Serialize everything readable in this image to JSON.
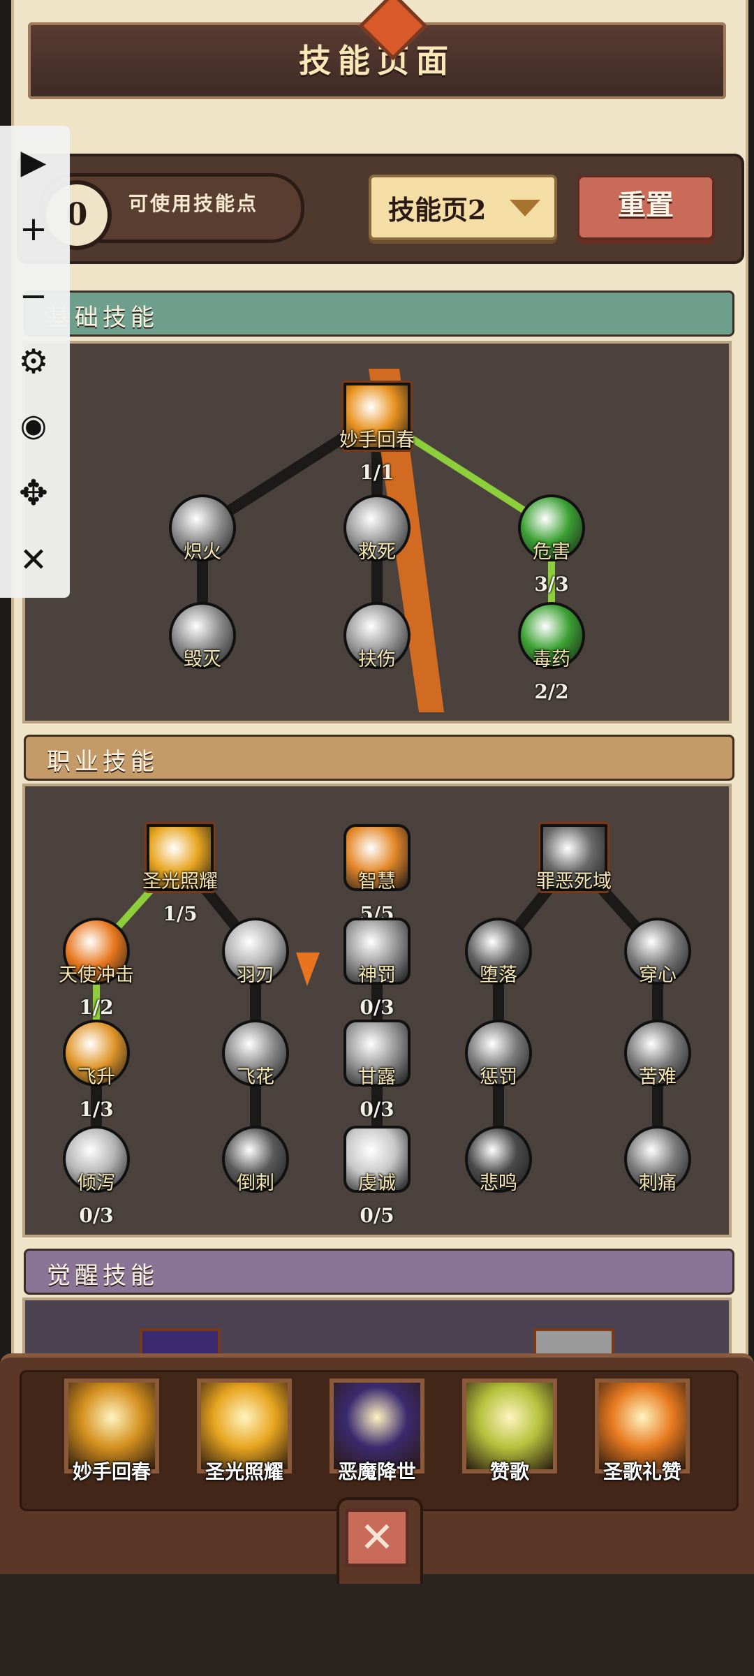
{
  "header": {
    "title": "技能页面"
  },
  "topbar": {
    "points_value": "0",
    "points_label": "可使用技能点",
    "page_select_value": "技能页2",
    "reset_label": "重置"
  },
  "sections": {
    "basic": {
      "title": "基础技能",
      "color": "#6e9e8c"
    },
    "class": {
      "title": "职业技能",
      "color": "#c39a68"
    },
    "awaken": {
      "title": "觉醒技能",
      "color": "#8a7596"
    }
  },
  "basic_skills": [
    {
      "key": "miaoshou",
      "label": "妙手回春",
      "count": "1/1",
      "icon": "golden-hand-icon",
      "color": "#e8921f",
      "shape": "square"
    },
    {
      "key": "chihuo",
      "label": "炽火",
      "count": "",
      "icon": "fire-strike-icon",
      "color": "#8c8c8c",
      "shape": "circle"
    },
    {
      "key": "jiusi",
      "label": "救死",
      "count": "",
      "icon": "revive-icon",
      "color": "#9a9a9a",
      "shape": "circle"
    },
    {
      "key": "weihai",
      "label": "危害",
      "count": "3/3",
      "icon": "green-spikes-icon",
      "color": "#3aa032",
      "shape": "circle"
    },
    {
      "key": "huimie",
      "label": "毁灭",
      "count": "",
      "icon": "destroy-icon",
      "color": "#8a8a8a",
      "shape": "circle"
    },
    {
      "key": "fushang",
      "label": "扶伤",
      "count": "",
      "icon": "heal-wound-icon",
      "color": "#9a9a9a",
      "shape": "circle"
    },
    {
      "key": "duyao",
      "label": "毒药",
      "count": "2/2",
      "icon": "poison-icon",
      "color": "#3aa032",
      "shape": "circle"
    }
  ],
  "class_skills": [
    {
      "key": "shengguang",
      "label": "圣光照耀",
      "count": "1/5",
      "icon": "holy-light-icon",
      "color": "#e7a51f",
      "shape": "square"
    },
    {
      "key": "zhihui",
      "label": "智慧",
      "count": "5/5",
      "icon": "wisdom-crown-icon",
      "color": "#e4882a",
      "shape": "roundsq"
    },
    {
      "key": "zuie",
      "label": "罪恶死域",
      "count": "",
      "icon": "death-domain-icon",
      "color": "#6a6a6a",
      "shape": "square"
    },
    {
      "key": "tianshi",
      "label": "天使冲击",
      "count": "1/2",
      "icon": "angel-strike-icon",
      "color": "#e8781f",
      "shape": "circle"
    },
    {
      "key": "yuren",
      "label": "羽刃",
      "count": "",
      "icon": "feather-blade-icon",
      "color": "#b0b0b0",
      "shape": "circle"
    },
    {
      "key": "shenfa",
      "label": "神罚",
      "count": "0/3",
      "icon": "divine-punish-icon",
      "color": "#9a9a9a",
      "shape": "roundsq"
    },
    {
      "key": "zhuiluo",
      "label": "堕落",
      "count": "",
      "icon": "fall-icon",
      "color": "#606060",
      "shape": "circle"
    },
    {
      "key": "chuanxin",
      "label": "穿心",
      "count": "",
      "icon": "pierce-heart-icon",
      "color": "#7a7a7a",
      "shape": "circle"
    },
    {
      "key": "feisheng",
      "label": "飞升",
      "count": "1/3",
      "icon": "ascend-icon",
      "color": "#e0962a",
      "shape": "circle"
    },
    {
      "key": "feihua",
      "label": "飞花",
      "count": "",
      "icon": "flying-petal-icon",
      "color": "#8a8a8a",
      "shape": "circle"
    },
    {
      "key": "ganlu",
      "label": "甘露",
      "count": "0/3",
      "icon": "dew-icon",
      "color": "#9a9a9a",
      "shape": "roundsq"
    },
    {
      "key": "chengfa",
      "label": "惩罚",
      "count": "",
      "icon": "punish-icon",
      "color": "#7a7a7a",
      "shape": "circle"
    },
    {
      "key": "kunan",
      "label": "苦难",
      "count": "",
      "icon": "suffering-icon",
      "color": "#7a7a7a",
      "shape": "circle"
    },
    {
      "key": "qingxie",
      "label": "倾泻",
      "count": "0/3",
      "icon": "vortex-icon",
      "color": "#b5b5b5",
      "shape": "circle"
    },
    {
      "key": "daoci",
      "label": "倒刺",
      "count": "",
      "icon": "barb-icon",
      "color": "#5a5a5a",
      "shape": "circle"
    },
    {
      "key": "qiancheng",
      "label": "虔诚",
      "count": "0/5",
      "icon": "devotion-icon",
      "color": "#c8c8c8",
      "shape": "roundsq"
    },
    {
      "key": "beiming",
      "label": "悲鸣",
      "count": "",
      "icon": "lament-grave-icon",
      "color": "#4a4a4a",
      "shape": "circle"
    },
    {
      "key": "citong",
      "label": "刺痛",
      "count": "",
      "icon": "sting-blade-icon",
      "color": "#7a7a7a",
      "shape": "circle"
    }
  ],
  "dock_skills": [
    {
      "label": "妙手回春",
      "icon": "golden-hand-icon",
      "color": "#d4901e"
    },
    {
      "label": "圣光照耀",
      "icon": "holy-light-icon",
      "color": "#e7a51f"
    },
    {
      "label": "恶魔降世",
      "icon": "demon-icon",
      "color": "#3b2a6e"
    },
    {
      "label": "赞歌",
      "icon": "praying-hands-icon",
      "color": "#b5c23c"
    },
    {
      "label": "圣歌礼赞",
      "icon": "hymn-icon",
      "color": "#e77a1f"
    }
  ],
  "controls": [
    "play-icon",
    "zoom-in-icon",
    "zoom-out-icon",
    "settings-gear-icon",
    "eye-icon",
    "move-icon",
    "close-icon"
  ]
}
